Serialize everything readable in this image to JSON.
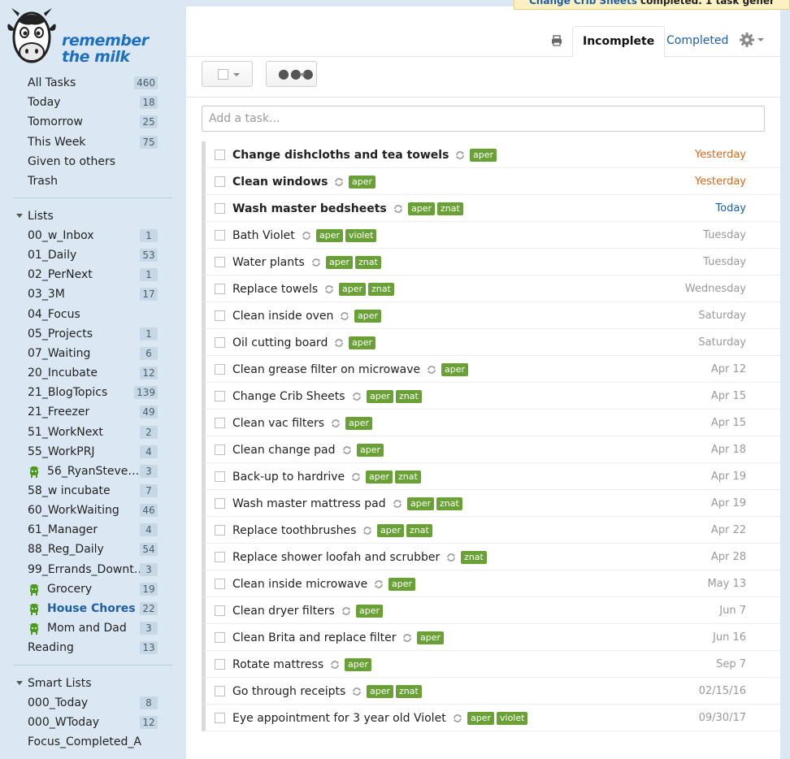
{
  "app": {
    "logo_text": [
      "remember",
      "the milk"
    ]
  },
  "sidebar": {
    "top_items": [
      {
        "label": "All Tasks",
        "count": "460"
      },
      {
        "label": "Today",
        "count": "18"
      },
      {
        "label": "Tomorrow",
        "count": "25"
      },
      {
        "label": "This Week",
        "count": "75"
      },
      {
        "label": "Given to others",
        "count": ""
      },
      {
        "label": "Trash",
        "count": ""
      }
    ],
    "lists_heading": "Lists",
    "lists": [
      {
        "label": "00_w_Inbox",
        "count": "1"
      },
      {
        "label": "01_Daily",
        "count": "53"
      },
      {
        "label": "02_PerNext",
        "count": "1"
      },
      {
        "label": "03_3M",
        "count": "17"
      },
      {
        "label": "04_Focus",
        "count": ""
      },
      {
        "label": "05_Projects",
        "count": "1"
      },
      {
        "label": "07_Waiting",
        "count": "6"
      },
      {
        "label": "20_Incubate",
        "count": "12"
      },
      {
        "label": "21_BlogTopics",
        "count": "139"
      },
      {
        "label": "21_Freezer",
        "count": "49"
      },
      {
        "label": "51_WorkNext",
        "count": "2"
      },
      {
        "label": "55_WorkPRJ",
        "count": "4"
      },
      {
        "label": "56_RyanSteven…",
        "count": "3",
        "shared": true
      },
      {
        "label": "58_w incubate",
        "count": "7"
      },
      {
        "label": "60_WorkWaiting",
        "count": "46"
      },
      {
        "label": "61_Manager",
        "count": "4"
      },
      {
        "label": "88_Reg_Daily",
        "count": "54"
      },
      {
        "label": "99_Errands_Downt…",
        "count": "3"
      },
      {
        "label": "Grocery",
        "count": "19",
        "shared": true
      },
      {
        "label": "House Chores",
        "count": "22",
        "shared": true,
        "active": true
      },
      {
        "label": "Mom and Dad",
        "count": "3",
        "shared": true
      },
      {
        "label": "Reading",
        "count": "13"
      }
    ],
    "smart_heading": "Smart Lists",
    "smart_lists": [
      {
        "label": "000_Today",
        "count": "8"
      },
      {
        "label": "000_WToday",
        "count": "12"
      },
      {
        "label": "Focus_Completed_A…",
        "count": ""
      }
    ]
  },
  "toast": {
    "link": "Change Crib Sheets",
    "message": " completed. 1 task gener"
  },
  "tabs": {
    "incomplete": "Incomplete",
    "completed": "Completed"
  },
  "add_task": {
    "placeholder": "Add a task..."
  },
  "colors": {
    "tag": "#6aa136",
    "overdue": "#d2691e",
    "today": "#1c5fa8",
    "link": "#1c5fa8"
  },
  "tasks": [
    {
      "title": "Change dishcloths and tea towels",
      "tags": [
        "aper"
      ],
      "due": "Yesterday",
      "status": "overdue",
      "bold": true
    },
    {
      "title": "Clean windows",
      "tags": [
        "aper"
      ],
      "due": "Yesterday",
      "status": "overdue",
      "bold": true
    },
    {
      "title": "Wash master bedsheets",
      "tags": [
        "aper",
        "znat"
      ],
      "due": "Today",
      "status": "today",
      "bold": true
    },
    {
      "title": "Bath Violet",
      "tags": [
        "aper",
        "violet"
      ],
      "due": "Tuesday"
    },
    {
      "title": "Water plants",
      "tags": [
        "aper",
        "znat"
      ],
      "due": "Tuesday"
    },
    {
      "title": "Replace towels",
      "tags": [
        "aper",
        "znat"
      ],
      "due": "Wednesday"
    },
    {
      "title": "Clean inside oven",
      "tags": [
        "aper"
      ],
      "due": "Saturday"
    },
    {
      "title": "Oil cutting board",
      "tags": [
        "aper"
      ],
      "due": "Saturday"
    },
    {
      "title": "Clean grease filter on microwave",
      "tags": [
        "aper"
      ],
      "due": "Apr 12"
    },
    {
      "title": "Change Crib Sheets",
      "tags": [
        "aper",
        "znat"
      ],
      "due": "Apr 15"
    },
    {
      "title": "Clean vac filters",
      "tags": [
        "aper"
      ],
      "due": "Apr 15"
    },
    {
      "title": "Clean change pad",
      "tags": [
        "aper"
      ],
      "due": "Apr 18"
    },
    {
      "title": "Back-up to hardrive",
      "tags": [
        "aper",
        "znat"
      ],
      "due": "Apr 19"
    },
    {
      "title": "Wash master mattress pad",
      "tags": [
        "aper",
        "znat"
      ],
      "due": "Apr 19"
    },
    {
      "title": "Replace toothbrushes",
      "tags": [
        "aper",
        "znat"
      ],
      "due": "Apr 22"
    },
    {
      "title": "Replace shower loofah and scrubber",
      "tags": [
        "znat"
      ],
      "due": "Apr 28"
    },
    {
      "title": "Clean inside microwave",
      "tags": [
        "aper"
      ],
      "due": "May 13"
    },
    {
      "title": "Clean dryer filters",
      "tags": [
        "aper"
      ],
      "due": "Jun 7"
    },
    {
      "title": "Clean Brita and replace filter",
      "tags": [
        "aper"
      ],
      "due": "Jun 16"
    },
    {
      "title": "Rotate mattress",
      "tags": [
        "aper"
      ],
      "due": "Sep 7"
    },
    {
      "title": "Go through receipts",
      "tags": [
        "aper",
        "znat"
      ],
      "due": "02/15/16"
    },
    {
      "title": "Eye appointment for 3 year old Violet",
      "tags": [
        "aper",
        "violet"
      ],
      "due": "09/30/17"
    }
  ]
}
